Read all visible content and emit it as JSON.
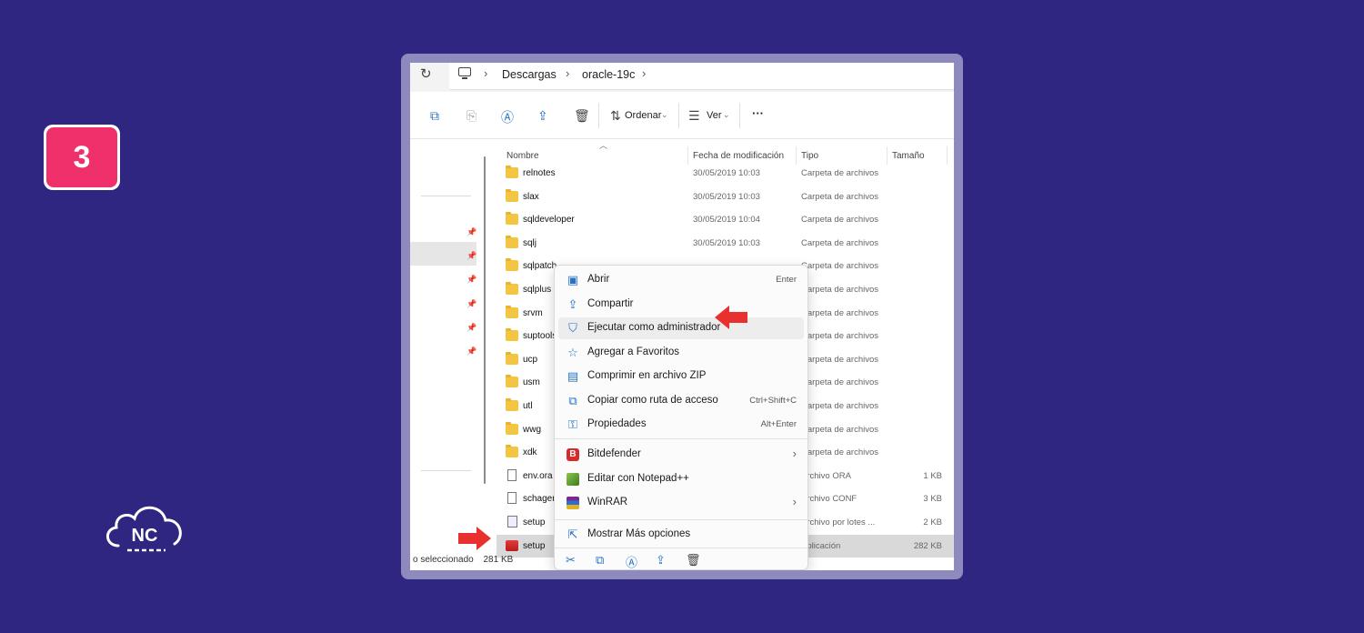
{
  "step_badge": "3",
  "logo_text": "NC",
  "breadcrumb": [
    "Descargas",
    "oracle-19c"
  ],
  "toolbar": {
    "sort_label": "Ordenar",
    "view_label": "Ver",
    "more_label": "···"
  },
  "columns": {
    "name": "Nombre",
    "date": "Fecha de modificación",
    "type": "Tipo",
    "size": "Tamaño"
  },
  "files": [
    {
      "name": "relnotes",
      "date": "30/05/2019 10:03",
      "type": "Carpeta de archivos",
      "size": "",
      "icon": "folder-icon"
    },
    {
      "name": "slax",
      "date": "30/05/2019 10:03",
      "type": "Carpeta de archivos",
      "size": "",
      "icon": "folder-icon"
    },
    {
      "name": "sqldeveloper",
      "date": "30/05/2019 10:04",
      "type": "Carpeta de archivos",
      "size": "",
      "icon": "folder-icon"
    },
    {
      "name": "sqlj",
      "date": "30/05/2019 10:03",
      "type": "Carpeta de archivos",
      "size": "",
      "icon": "folder-icon"
    },
    {
      "name": "sqlpatch",
      "date": "",
      "type": "Carpeta de archivos",
      "size": "",
      "icon": "folder-icon"
    },
    {
      "name": "sqlplus",
      "date": "",
      "type": "Carpeta de archivos",
      "size": "",
      "icon": "folder-icon"
    },
    {
      "name": "srvm",
      "date": "",
      "type": "Carpeta de archivos",
      "size": "",
      "icon": "folder-icon"
    },
    {
      "name": "suptools",
      "date": "",
      "type": "Carpeta de archivos",
      "size": "",
      "icon": "folder-icon"
    },
    {
      "name": "ucp",
      "date": "",
      "type": "Carpeta de archivos",
      "size": "",
      "icon": "folder-icon"
    },
    {
      "name": "usm",
      "date": "",
      "type": "Carpeta de archivos",
      "size": "",
      "icon": "folder-icon"
    },
    {
      "name": "utl",
      "date": "",
      "type": "Carpeta de archivos",
      "size": "",
      "icon": "folder-icon"
    },
    {
      "name": "wwg",
      "date": "",
      "type": "Carpeta de archivos",
      "size": "",
      "icon": "folder-icon"
    },
    {
      "name": "xdk",
      "date": "",
      "type": "Carpeta de archivos",
      "size": "",
      "icon": "folder-icon"
    },
    {
      "name": "env.ora",
      "date": "",
      "type": "Archivo ORA",
      "size": "1 KB",
      "icon": "file-icon"
    },
    {
      "name": "schager",
      "date": "",
      "type": "Archivo CONF",
      "size": "3 KB",
      "icon": "file-icon"
    },
    {
      "name": "setup",
      "date": "",
      "type": "Archivo por lotes ...",
      "size": "2 KB",
      "icon": "bat-icon"
    },
    {
      "name": "setup",
      "date": "",
      "type": "Aplicación",
      "size": "282 KB",
      "icon": "app-icon",
      "selected": true
    }
  ],
  "status": {
    "selected": "o seleccionado",
    "size": "281 KB"
  },
  "context_menu": {
    "items": [
      {
        "label": "Abrir",
        "shortcut": "Enter",
        "icon": "open-icon"
      },
      {
        "label": "Compartir",
        "shortcut": "",
        "icon": "share-icon"
      },
      {
        "label": "Ejecutar como administrador",
        "shortcut": "",
        "icon": "shield-icon",
        "hover": true
      },
      {
        "label": "Agregar a Favoritos",
        "shortcut": "",
        "icon": "star-icon"
      },
      {
        "label": "Comprimir en archivo ZIP",
        "shortcut": "",
        "icon": "zip-icon"
      },
      {
        "label": "Copiar como ruta de acceso",
        "shortcut": "Ctrl+Shift+C",
        "icon": "path-icon"
      },
      {
        "label": "Propiedades",
        "shortcut": "Alt+Enter",
        "icon": "wrench-icon"
      }
    ],
    "apps": [
      {
        "label": "Bitdefender",
        "icon": "bitdefender-icon",
        "submenu": true
      },
      {
        "label": "Editar con Notepad++",
        "icon": "notepad-icon",
        "submenu": false
      },
      {
        "label": "WinRAR",
        "icon": "winrar-icon",
        "submenu": true
      }
    ],
    "more_label": "Mostrar Más opciones"
  },
  "colors": {
    "background": "#2e2680",
    "badge": "#f0306b",
    "arrow": "#e8312f",
    "accent": "#2673c5"
  }
}
